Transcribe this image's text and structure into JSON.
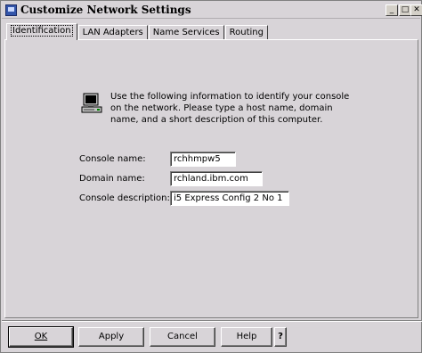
{
  "window": {
    "title": "Customize Network Settings",
    "controls": {
      "minimize": "_",
      "maximize": "□",
      "close": "✕"
    }
  },
  "tabs": [
    {
      "label": "Identification",
      "active": true
    },
    {
      "label": "LAN Adapters",
      "active": false
    },
    {
      "label": "Name Services",
      "active": false
    },
    {
      "label": "Routing",
      "active": false
    }
  ],
  "intro_text": "Use the following information to identify your console on the network. Please type a host name, domain name, and a short description of this computer.",
  "intro_icon": "computer-icon",
  "form": {
    "console_name": {
      "label": "Console name:",
      "value": "rchhmpw5"
    },
    "domain_name": {
      "label": "Domain name:",
      "value": "rchland.ibm.com"
    },
    "console_description": {
      "label": "Console description:",
      "value": "i5 Express Config 2 No 1"
    }
  },
  "buttons": {
    "ok": "OK",
    "apply": "Apply",
    "cancel": "Cancel",
    "help": "Help",
    "whats_this": "?"
  }
}
